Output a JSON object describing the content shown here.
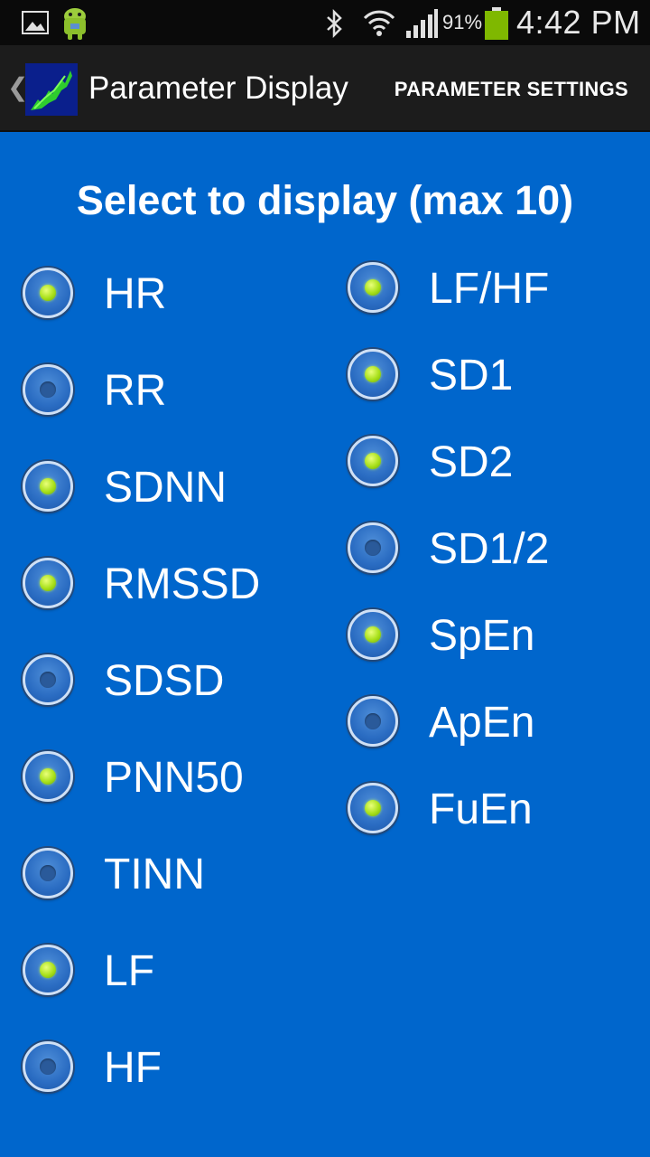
{
  "status_bar": {
    "battery_percent": "91%",
    "time": "4:42 PM",
    "icons": [
      "gallery-icon",
      "android-icon",
      "bluetooth-icon",
      "wifi-icon",
      "signal-icon",
      "battery-icon"
    ]
  },
  "action_bar": {
    "title": "Parameter Display",
    "action_label": "PARAMETER SETTINGS"
  },
  "heading": "Select to display (max 10)",
  "left_column": [
    {
      "label": "HR",
      "selected": true
    },
    {
      "label": "RR",
      "selected": false
    },
    {
      "label": "SDNN",
      "selected": true
    },
    {
      "label": "RMSSD",
      "selected": true
    },
    {
      "label": "SDSD",
      "selected": false
    },
    {
      "label": "PNN50",
      "selected": true
    },
    {
      "label": "TINN",
      "selected": false
    },
    {
      "label": "LF",
      "selected": true
    },
    {
      "label": "HF",
      "selected": false
    }
  ],
  "right_column": [
    {
      "label": "LF/HF",
      "selected": true
    },
    {
      "label": "SD1",
      "selected": true
    },
    {
      "label": "SD2",
      "selected": true
    },
    {
      "label": "SD1/2",
      "selected": false
    },
    {
      "label": "SpEn",
      "selected": true
    },
    {
      "label": "ApEn",
      "selected": false
    },
    {
      "label": "FuEn",
      "selected": true
    }
  ],
  "colors": {
    "background": "#0066cc",
    "status_bar": "#0a0a0a",
    "action_bar": "#1c1c1c",
    "radio_checked_dot": "#a8e01a"
  }
}
